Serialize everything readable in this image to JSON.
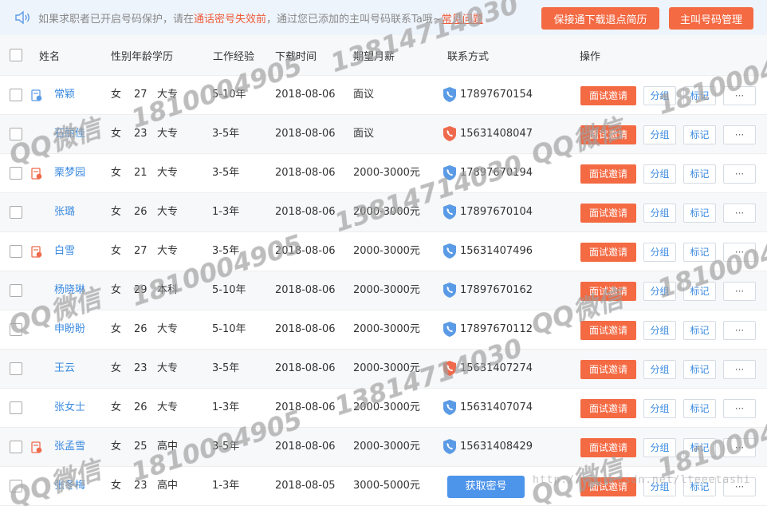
{
  "notice": {
    "part1": "如果求职者已开启号码保护，请在",
    "highlight": "通话密号失效前",
    "part2": "，通过您已添加的主叫号码联系Ta哦~",
    "faq": "常见问题"
  },
  "buttons": {
    "keep_download": "保接通下载退点简历",
    "caller_manage": "主叫号码管理"
  },
  "headers": {
    "name": "姓名",
    "gender_age_edu": "性别年龄学历",
    "experience": "工作经验",
    "download_time": "下载时间",
    "salary": "期望月薪",
    "contact": "联系方式",
    "action": "操作"
  },
  "row_actions": {
    "invite": "面试邀请",
    "group": "分组",
    "mark": "标记",
    "more": "···",
    "get_pwd": "获取密号"
  },
  "rows": [
    {
      "status": "blue",
      "name": "常颖",
      "gender": "女",
      "age": "27",
      "edu": "大专",
      "exp": "5-10年",
      "time": "2018-08-06",
      "salary": "面议",
      "phone_type": "blue",
      "phone": "17897670154"
    },
    {
      "status": "",
      "name": "石丽佳",
      "gender": "女",
      "age": "23",
      "edu": "大专",
      "exp": "3-5年",
      "time": "2018-08-06",
      "salary": "面议",
      "phone_type": "red",
      "phone": "15631408047"
    },
    {
      "status": "red",
      "name": "栗梦园",
      "gender": "女",
      "age": "21",
      "edu": "大专",
      "exp": "3-5年",
      "time": "2018-08-06",
      "salary": "2000-3000元",
      "phone_type": "blue",
      "phone": "17897670194"
    },
    {
      "status": "",
      "name": "张璐",
      "gender": "女",
      "age": "26",
      "edu": "大专",
      "exp": "1-3年",
      "time": "2018-08-06",
      "salary": "2000-3000元",
      "phone_type": "blue",
      "phone": "17897670104"
    },
    {
      "status": "red",
      "name": "白雪",
      "gender": "女",
      "age": "27",
      "edu": "大专",
      "exp": "3-5年",
      "time": "2018-08-06",
      "salary": "2000-3000元",
      "phone_type": "blue",
      "phone": "15631407496"
    },
    {
      "status": "",
      "name": "杨晓琳",
      "gender": "女",
      "age": "29",
      "edu": "本科",
      "exp": "5-10年",
      "time": "2018-08-06",
      "salary": "2000-3000元",
      "phone_type": "blue",
      "phone": "17897670162"
    },
    {
      "status": "",
      "name": "申盼盼",
      "gender": "女",
      "age": "26",
      "edu": "大专",
      "exp": "5-10年",
      "time": "2018-08-06",
      "salary": "2000-3000元",
      "phone_type": "blue",
      "phone": "17897670112"
    },
    {
      "status": "",
      "name": "王云",
      "gender": "女",
      "age": "23",
      "edu": "大专",
      "exp": "3-5年",
      "time": "2018-08-06",
      "salary": "2000-3000元",
      "phone_type": "red",
      "phone": "15631407274"
    },
    {
      "status": "",
      "name": "张女士",
      "gender": "女",
      "age": "26",
      "edu": "大专",
      "exp": "1-3年",
      "time": "2018-08-06",
      "salary": "2000-3000元",
      "phone_type": "blue",
      "phone": "15631407074"
    },
    {
      "status": "red",
      "name": "张孟雪",
      "gender": "女",
      "age": "25",
      "edu": "高中",
      "exp": "3-5年",
      "time": "2018-08-06",
      "salary": "2000-3000元",
      "phone_type": "blue",
      "phone": "15631408429"
    },
    {
      "status": "",
      "name": "张冬梅",
      "gender": "女",
      "age": "23",
      "edu": "高中",
      "exp": "1-3年",
      "time": "2018-08-05",
      "salary": "3000-5000元",
      "phone_type": "button",
      "phone": ""
    }
  ],
  "watermarks": {
    "phone1": "13814714030",
    "phone2": "1810004905",
    "qq": "QQ微信",
    "url": "http://blog.csdn.net/lteeetashi"
  },
  "colors": {
    "accent_orange": "#f46a43",
    "link_blue": "#3c8be0",
    "phone_blue": "#5b9be6",
    "phone_red": "#ef6a4c"
  }
}
